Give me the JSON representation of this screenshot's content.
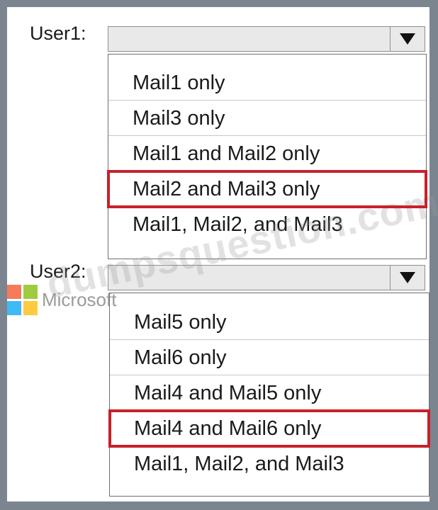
{
  "user1": {
    "label": "User1:",
    "options": [
      "Mail1 only",
      "Mail3 only",
      "Mail1 and Mail2 only",
      "Mail2 and Mail3 only",
      "Mail1, Mail2, and Mail3"
    ],
    "selected_index": 3
  },
  "user2": {
    "label": "User2:",
    "options": [
      "Mail5 only",
      "Mail6 only",
      "Mail4 and Mail5 only",
      "Mail4 and Mail6 only",
      "Mail1, Mail2, and Mail3"
    ],
    "selected_index": 3
  },
  "logo": {
    "text": "Microsoft",
    "colors": [
      "#f25022",
      "#7fba00",
      "#00a4ef",
      "#ffb900"
    ]
  },
  "watermark": {
    "text": "dumpsquestion.com"
  },
  "colors": {
    "highlight": "#c8202a",
    "background": "#7a8590"
  }
}
